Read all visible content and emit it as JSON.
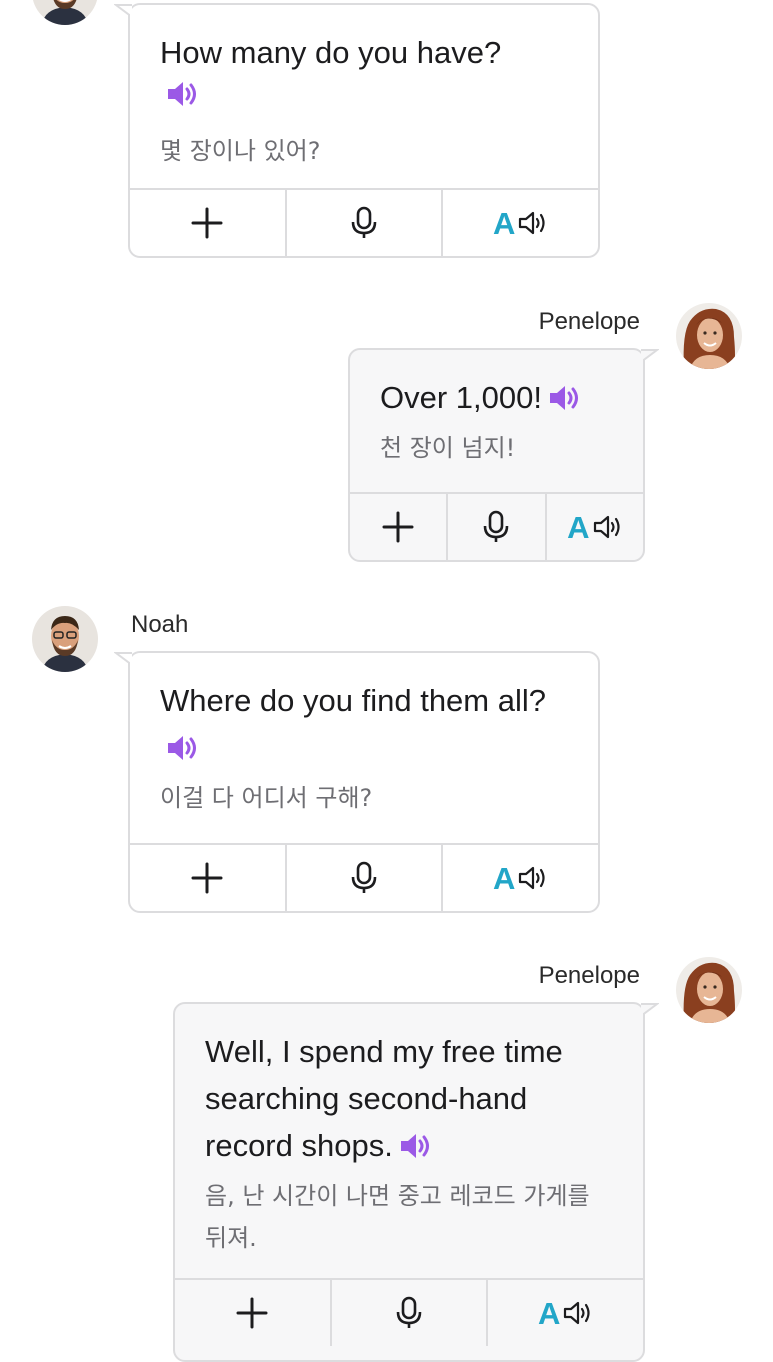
{
  "messages": [
    {
      "speaker": "Noah",
      "name_visible": false,
      "english": "How many do you have?",
      "korean": "몇 장이나 있어?"
    },
    {
      "speaker": "Penelope",
      "name_visible": true,
      "english": "Over 1,000!",
      "korean": "천 장이 넘지!"
    },
    {
      "speaker": "Noah",
      "name_visible": true,
      "english": "Where do you find them all?",
      "korean": "이걸 다 어디서 구해?"
    },
    {
      "speaker": "Penelope",
      "name_visible": true,
      "english": "Well, I spend my free time searching second-hand record shops.",
      "korean": "음, 난 시간이 나면 중고 레코드 가게를 뒤져."
    }
  ],
  "actions": {
    "tts_letter": "A"
  },
  "icons": {
    "add": "plus-icon",
    "record": "microphone-icon",
    "play": "speaker-icon",
    "translate_tts": "letter-a-speaker-icon"
  },
  "colors": {
    "accent_purple": "#9b59e6",
    "accent_teal": "#22a6c8",
    "border": "#dcdcde",
    "korean_text": "#6e6e73"
  }
}
